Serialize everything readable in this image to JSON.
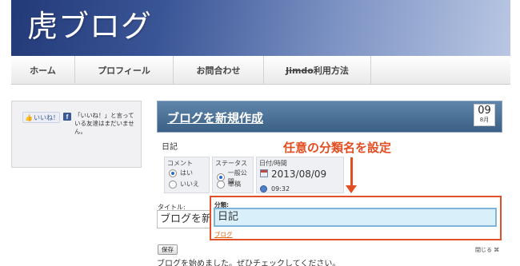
{
  "site": {
    "title": "虎ブログ"
  },
  "nav": {
    "items": [
      {
        "label": "ホーム"
      },
      {
        "label": "プロフィール"
      },
      {
        "label": "お問合わせ"
      },
      {
        "label_prefix": "Jimdo",
        "label_suffix": "利用方法"
      }
    ]
  },
  "sidebar": {
    "like_label": "いいね！",
    "like_text": "「いいね！」と言っている友達はまだいません。"
  },
  "post": {
    "header_title": "ブログを新規作成",
    "date_day": "09",
    "date_month": "8月",
    "section_label": "日記",
    "comment": {
      "label": "コメント",
      "options": [
        "はい",
        "いいえ"
      ],
      "selected": "はい"
    },
    "status": {
      "label": "ステータス",
      "options": [
        "一般公開",
        "草稿"
      ],
      "selected": "一般公開"
    },
    "datetime": {
      "label": "日付/時間",
      "date": "2013/08/09",
      "time": "09:32"
    },
    "title_label": "タイトル:",
    "title_value": "ブログを新規作成",
    "category": {
      "label": "分類:",
      "value": "日記",
      "link": "ブログ"
    },
    "save_label": "保存",
    "close_label": "閉じる ⌘",
    "bottom_text": "ブログを始めました。ぜひチェックしてください。"
  },
  "annotation": {
    "text": "任意の分類名を設定",
    "color": "#e24e22"
  },
  "colors": {
    "accent": "#e24e22",
    "header_bg": "#3a5596",
    "input_highlight": "#d9effa"
  }
}
